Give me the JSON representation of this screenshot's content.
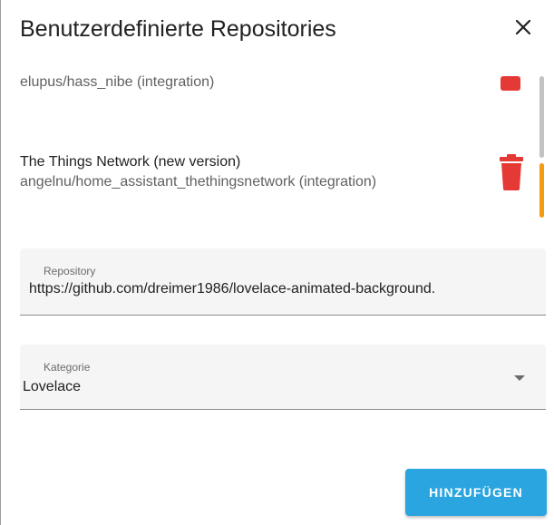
{
  "dialog": {
    "title": "Benutzerdefinierte Repositories",
    "close_icon": "close-icon"
  },
  "repositories": [
    {
      "name": "",
      "subtitle": "elupus/hass_nibe (integration)",
      "delete_icon": "trash-icon"
    },
    {
      "name": "The Things Network (new version)",
      "subtitle": "angelnu/home_assistant_thethingsnetwork (integration)",
      "delete_icon": "trash-icon"
    }
  ],
  "form": {
    "repository": {
      "label": "Repository",
      "value": "https://github.com/dreimer1986/lovelace-animated-background."
    },
    "category": {
      "label": "Kategorie",
      "value": "Lovelace",
      "arrow_icon": "dropdown-arrow-icon"
    },
    "add_button": "HINZUFÜGEN"
  },
  "colors": {
    "accent": "#2aa5e0",
    "delete": "#e53935",
    "scroll_thumb": "#f39c12"
  }
}
